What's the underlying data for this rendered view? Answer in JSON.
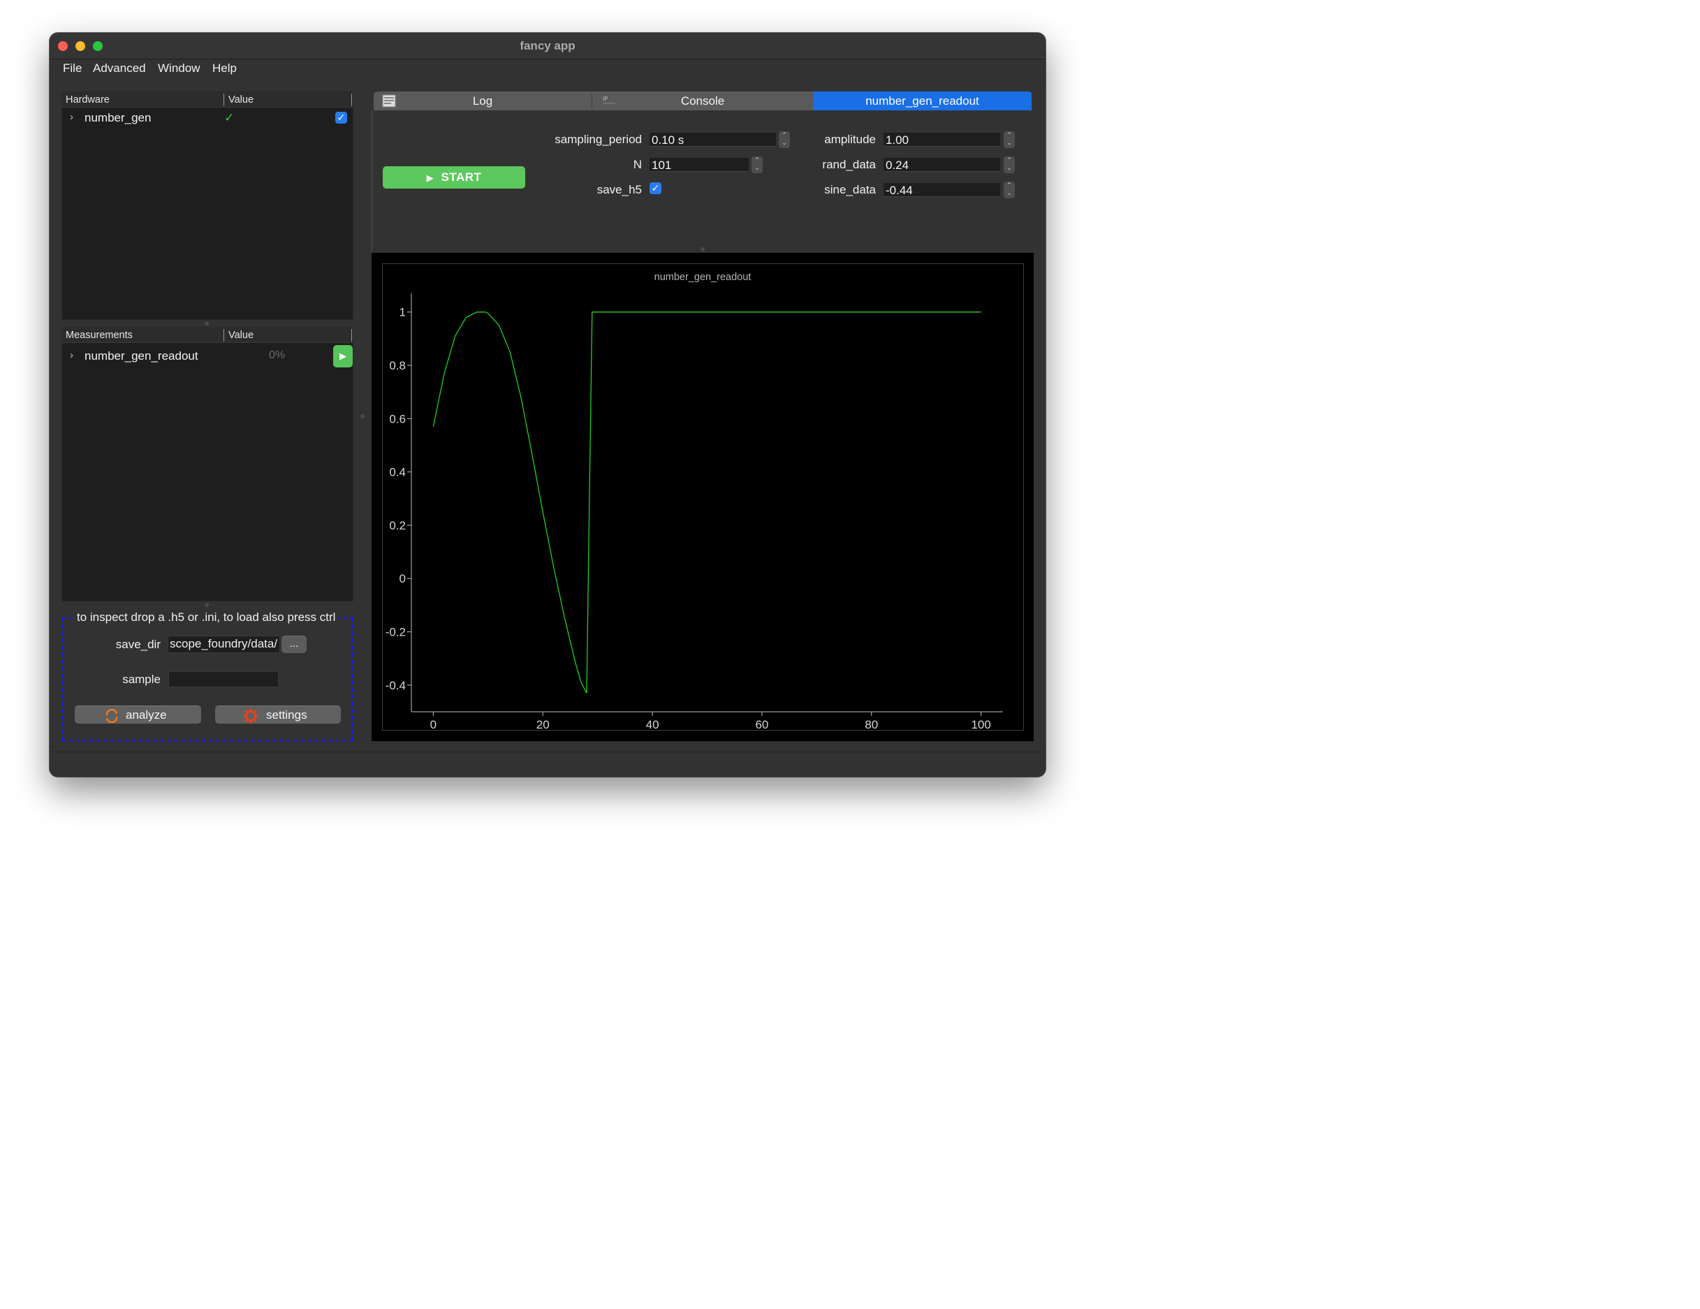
{
  "window": {
    "title": "fancy app"
  },
  "menu": [
    "File",
    "Advanced",
    "Window",
    "Help"
  ],
  "hardware_panel": {
    "col_name": "Hardware",
    "col_value": "Value",
    "items": [
      {
        "label": "number_gen",
        "status": "✓",
        "enabled": true
      }
    ]
  },
  "measurements_panel": {
    "col_name": "Measurements",
    "col_value": "Value",
    "items": [
      {
        "label": "number_gen_readout",
        "progress_text": "0%",
        "progress": 0
      }
    ]
  },
  "drop_area": {
    "title": "to inspect drop a .h5 or .ini, to load also press ctrl",
    "save_dir_label": "save_dir",
    "save_dir_value": "/scope_foundry/data",
    "browse_label": "...",
    "sample_label": "sample",
    "sample_value": "",
    "analyze_label": "analyze",
    "settings_label": "settings"
  },
  "tabs": [
    {
      "label": "Log",
      "icon": "log-icon",
      "active": false
    },
    {
      "label": "Console",
      "icon": "ipython-icon",
      "active": false
    },
    {
      "label": "number_gen_readout",
      "icon": "",
      "active": true
    }
  ],
  "controls": {
    "start_label": "START",
    "sampling_period_label": "sampling_period",
    "sampling_period_value": "0.10 s",
    "n_label": "N",
    "n_value": "101",
    "save_h5_label": "save_h5",
    "save_h5_checked": true,
    "amplitude_label": "amplitude",
    "amplitude_value": "1.00",
    "rand_data_label": "rand_data",
    "rand_data_value": "0.24",
    "sine_data_label": "sine_data",
    "sine_data_value": "-0.44"
  },
  "colors": {
    "accent": "#1a6ee6",
    "start": "#5cc85d",
    "trace": "#22d022",
    "drop_border": "#1a1af0"
  },
  "chart_data": {
    "type": "line",
    "title": "number_gen_readout",
    "xlim": [
      -4,
      104
    ],
    "ylim": [
      -0.5,
      1.07
    ],
    "xticks": [
      0,
      20,
      40,
      60,
      80,
      100
    ],
    "yticks": [
      1,
      0.8,
      0.6,
      0.4,
      0.2,
      0,
      -0.2,
      -0.4
    ],
    "ytick_labels": [
      "1",
      "0.8",
      "0.6",
      "0.4",
      "0.2",
      "0",
      "-0.2",
      "-0.4"
    ],
    "series": [
      {
        "x": [
          0,
          2,
          4,
          6,
          8,
          9.5,
          10,
          12,
          14,
          16,
          18,
          20,
          22,
          24,
          26,
          27,
          28,
          28.5,
          29,
          40,
          60,
          80,
          100
        ],
        "values": [
          0.57,
          0.77,
          0.91,
          0.98,
          1.0,
          1.0,
          0.995,
          0.95,
          0.85,
          0.68,
          0.47,
          0.25,
          0.04,
          -0.15,
          -0.32,
          -0.39,
          -0.43,
          0.3,
          1.0,
          1.0,
          1.0,
          1.0,
          1.0
        ]
      }
    ]
  }
}
